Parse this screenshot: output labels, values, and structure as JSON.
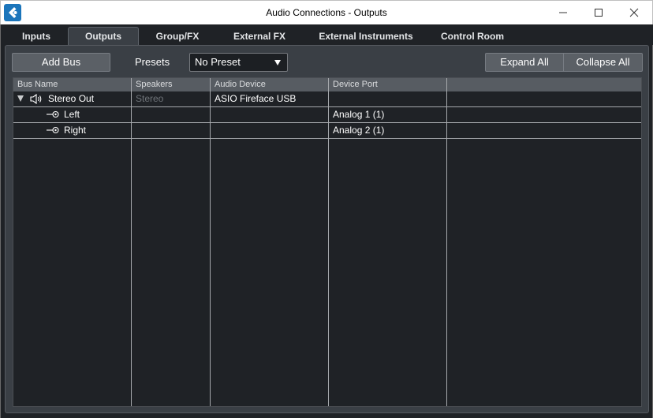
{
  "window": {
    "title": "Audio Connections - Outputs",
    "app_icon": "cubase-logo-icon",
    "controls": [
      "minimize-icon",
      "maximize-icon",
      "close-icon"
    ]
  },
  "tabs": [
    {
      "label": "Inputs",
      "active": false
    },
    {
      "label": "Outputs",
      "active": true
    },
    {
      "label": "Group/FX",
      "active": false
    },
    {
      "label": "External FX",
      "active": false
    },
    {
      "label": "External Instruments",
      "active": false
    },
    {
      "label": "Control Room",
      "active": false
    }
  ],
  "toolbar": {
    "add_bus_label": "Add Bus",
    "presets_label": "Presets",
    "preset_value": "No Preset",
    "expand_all_label": "Expand All",
    "collapse_all_label": "Collapse All"
  },
  "table": {
    "columns": [
      "Bus Name",
      "Speakers",
      "Audio Device",
      "Device Port"
    ],
    "rows": [
      {
        "bus_name": "Stereo Out",
        "speakers": "Stereo",
        "audio_device": "ASIO Fireface USB",
        "device_port": "",
        "level": 0,
        "expanded": true,
        "icon": "speaker-icon"
      },
      {
        "bus_name": "Left",
        "speakers": "",
        "audio_device": "",
        "device_port": "Analog 1 (1)",
        "level": 1,
        "icon": "output-port-icon"
      },
      {
        "bus_name": "Right",
        "speakers": "",
        "audio_device": "",
        "device_port": "Analog 2 (1)",
        "level": 1,
        "icon": "output-port-icon"
      }
    ]
  },
  "colors": {
    "background": "#1f2226",
    "panel": "#3a3f45",
    "button": "#5b6066",
    "header": "#575c62",
    "accent": "#1b75bb"
  }
}
